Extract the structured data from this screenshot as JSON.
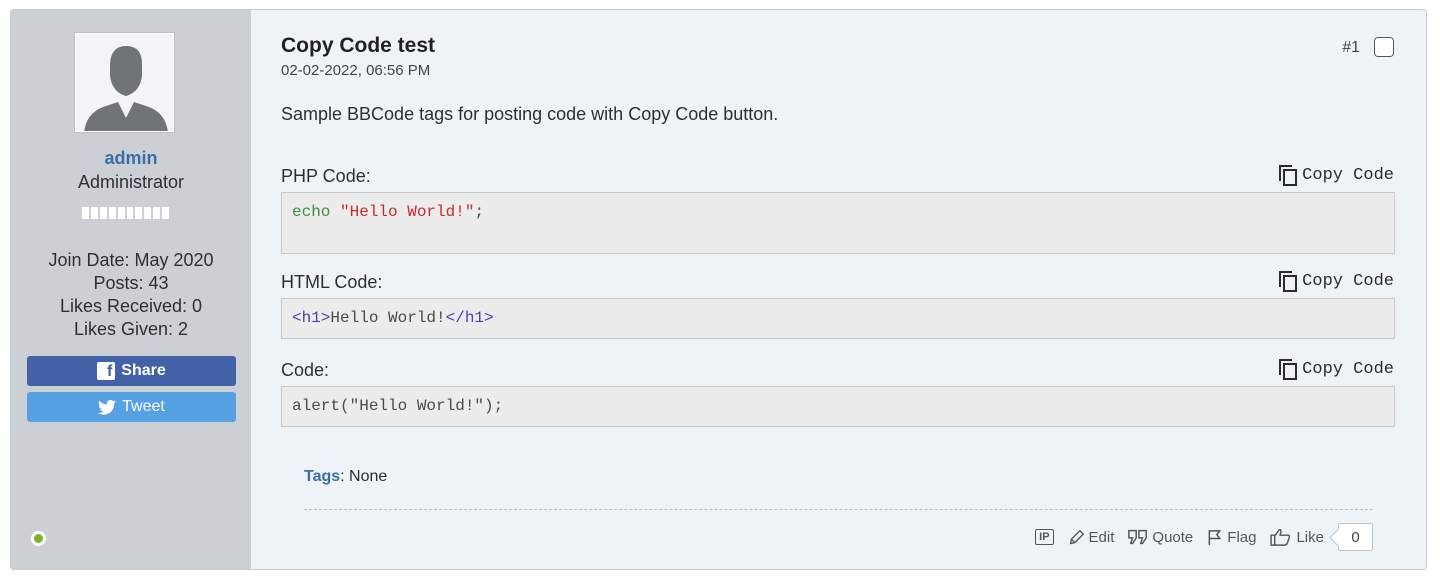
{
  "user": {
    "username": "admin",
    "title": "Administrator",
    "join_date": "Join Date: May 2020",
    "posts": "Posts: 43",
    "likes_received": "Likes Received: 0",
    "likes_given": "Likes Given: 2",
    "share_label": "Share",
    "tweet_label": "Tweet",
    "online_color": "#7cb32a"
  },
  "post": {
    "title": "Copy Code test",
    "date": "02-02-2022, 06:56 PM",
    "number": "#1",
    "text": "Sample BBCode tags for posting code with Copy Code button."
  },
  "code_blocks": [
    {
      "label": "PHP Code:",
      "copy_label": "Copy Code",
      "fn": "echo",
      "string": "\"Hello World!\"",
      "end": ";"
    },
    {
      "label": "HTML Code:",
      "copy_label": "Copy Code",
      "open_tag": "<h1>",
      "content": "Hello World!",
      "close_tag": "</h1>"
    },
    {
      "label": "Code:",
      "copy_label": "Copy Code",
      "code": "alert(\"Hello World!\");"
    }
  ],
  "tags": {
    "label": "Tags",
    "value": ": None"
  },
  "actions": {
    "ip": "IP",
    "edit": "Edit",
    "quote": "Quote",
    "flag": "Flag",
    "like": "Like",
    "like_count": "0"
  }
}
